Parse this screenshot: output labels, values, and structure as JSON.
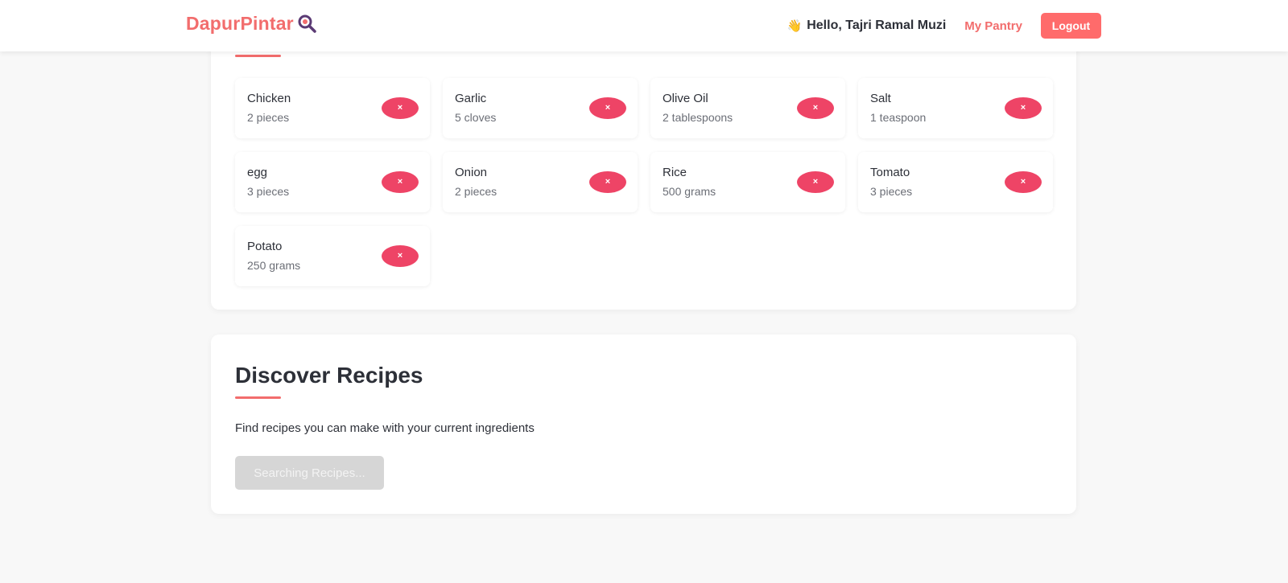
{
  "navbar": {
    "brand": "DapurPintar",
    "brand_icon": "search-magnifier-icon",
    "greeting_emoji": "👋",
    "greeting": "Hello, Tajri Ramal Muzi",
    "pantry_link": "My Pantry",
    "logout": "Logout"
  },
  "pantry": {
    "remove_symbol": "×",
    "items": [
      {
        "name": "Chicken",
        "quantity": "2 pieces"
      },
      {
        "name": "Garlic",
        "quantity": "5 cloves"
      },
      {
        "name": "Olive Oil",
        "quantity": "2 tablespoons"
      },
      {
        "name": "Salt",
        "quantity": "1 teaspoon"
      },
      {
        "name": "egg",
        "quantity": "3 pieces"
      },
      {
        "name": "Onion",
        "quantity": "2 pieces"
      },
      {
        "name": "Rice",
        "quantity": "500 grams"
      },
      {
        "name": "Tomato",
        "quantity": "3 pieces"
      },
      {
        "name": "Potato",
        "quantity": "250 grams"
      }
    ]
  },
  "discover": {
    "title": "Discover Recipes",
    "description": "Find recipes you can make with your current ingredients",
    "button": "Searching Recipes..."
  },
  "colors": {
    "brand": "#f26d6d",
    "logout_bg": "#ff6b6b",
    "remove_bg": "#ee4466",
    "disabled_bg": "#d6d6d6",
    "brand_icon_color": "#5b3a74"
  }
}
